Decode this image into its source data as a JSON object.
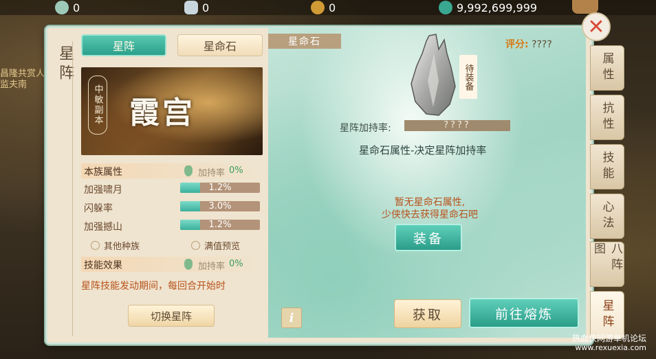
{
  "topbar": {
    "res1": "0",
    "res2": "0",
    "res3": "0",
    "res4": "9,992,699,999"
  },
  "background": {
    "left_text_line1": "昌隆共赏人",
    "left_text_line2": "监夫南"
  },
  "panel": {
    "side_title": "星阵",
    "tabs": [
      "星阵",
      "星命石"
    ],
    "dungeon": {
      "subtitle": "中敏副本",
      "name": "霞宫"
    },
    "race_section": {
      "label": "本族属性",
      "rate_label": "加持率",
      "rate": "0%"
    },
    "attributes": [
      {
        "name": "加强啸月",
        "value": "1.2%",
        "fill": 0.25
      },
      {
        "name": "闪躲率",
        "value": "3.0%",
        "fill": 0.25
      },
      {
        "name": "加强撼山",
        "value": "1.2%",
        "fill": 0.25
      }
    ],
    "links": {
      "other_races": "其他种族",
      "max_preview": "满值预览"
    },
    "skill_section": {
      "label": "技能效果",
      "rate_label": "加持率",
      "rate": "0%"
    },
    "skill_desc": "星阵技能发动期间，每回合开始时",
    "switch_button": "切换星阵"
  },
  "stone": {
    "tag": "星命石",
    "score_label": "评分:",
    "score_value": "????",
    "await_label": "待装备",
    "bonus_label": "星阵加持率:",
    "bonus_value": "????",
    "attr_title": "星命石属性-决定星阵加持率",
    "no_attr_line1": "暂无星命石属性,",
    "no_attr_line2": "少侠快去获得星命石吧",
    "equip_button": "装备",
    "info_button": "i",
    "get_button": "获取",
    "refine_button": "前往熔炼"
  },
  "right_tabs": [
    "属性",
    "抗性",
    "技能",
    "心法",
    "八阵图",
    "星阵"
  ],
  "right_tab_active": "星阵",
  "watermark": {
    "line1": "热血侠网游单机论坛",
    "line2": "www.rexuexia.com"
  },
  "colors": {
    "accent_green": "#2aa08b",
    "highlight_orange": "#b8521c",
    "panel_bg": "#efe4cf"
  }
}
